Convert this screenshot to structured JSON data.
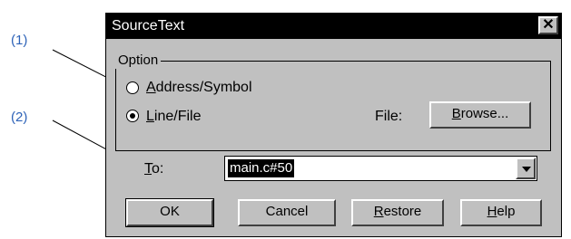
{
  "callouts": {
    "one": "(1)",
    "two": "(2)"
  },
  "dialog": {
    "title": "SourceText",
    "close_glyph": "✕",
    "option_group": {
      "label": "Option",
      "radio_address": {
        "label_first": "A",
        "label_rest": "ddress/Symbol",
        "selected": false
      },
      "radio_line": {
        "label_first": "L",
        "label_rest": "ine/File",
        "selected": true
      },
      "file_label": "File:",
      "browse_first": "B",
      "browse_rest": "rowse..."
    },
    "to": {
      "label_first": "T",
      "label_rest": "o:",
      "value": "main.c#50"
    },
    "buttons": {
      "ok": "OK",
      "cancel": "Cancel",
      "restore_first": "R",
      "restore_rest": "estore",
      "help_first": "H",
      "help_rest": "elp"
    }
  },
  "colors": {
    "callout": "#2e63b8",
    "dialog_face": "#c0c0c0",
    "titlebar": "#000000"
  }
}
